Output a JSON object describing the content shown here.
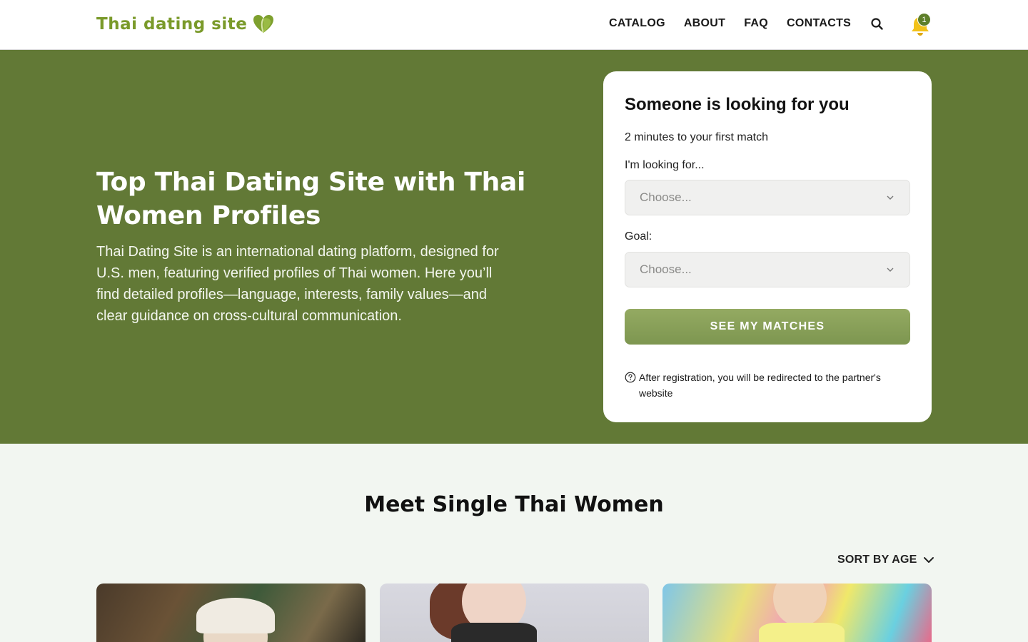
{
  "header": {
    "logo_text": "Thai dating site",
    "nav": [
      "CATALOG",
      "ABOUT",
      "FAQ",
      "CONTACTS"
    ],
    "notification_count": "1",
    "icons": [
      "search-icon",
      "bell-icon",
      "heart-logo-icon"
    ]
  },
  "hero": {
    "title": "Top Thai Dating Site with Thai Women Profiles",
    "description": "Thai Dating Site is an international dating platform, designed for U.S. men, featuring verified profiles of Thai women. Here you’ll find detailed profiles—language, interests, family values—and clear guidance on cross-cultural communication."
  },
  "form": {
    "title": "Someone is looking for you",
    "subtitle": "2 minutes to your first match",
    "looking_for_label": "I'm looking for...",
    "looking_for_value": "Choose...",
    "goal_label": "Goal:",
    "goal_value": "Choose...",
    "cta": "SEE MY MATCHES",
    "note": "After registration, you will be redirected to the partner's website"
  },
  "section": {
    "title": "Meet Single Thai Women",
    "sort_label": "SORT BY AGE"
  },
  "colors": {
    "brand_green": "#627936",
    "cta_green": "#8aa15a",
    "logo_green": "#7a9a2a",
    "bell_yellow": "#f2c21a"
  }
}
